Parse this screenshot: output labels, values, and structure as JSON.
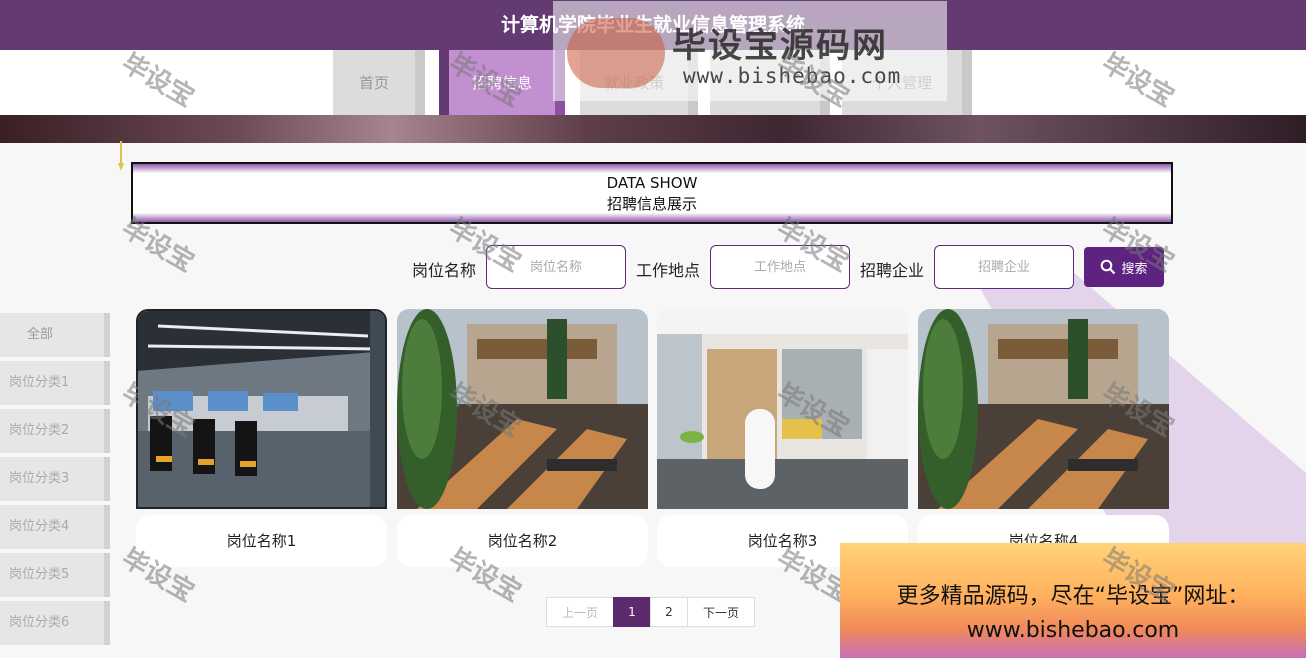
{
  "header": {
    "title": "计算机学院毕业生就业信息管理系统"
  },
  "nav": {
    "items": [
      {
        "label": "首页"
      },
      {
        "label": "招聘信息"
      },
      {
        "label": "就业政策"
      },
      {
        "label": ""
      },
      {
        "label": "个人管理"
      }
    ],
    "active": "招聘信息"
  },
  "section": {
    "title_en": "DATA SHOW",
    "title_cn": "招聘信息展示"
  },
  "search": {
    "position_label": "岗位名称",
    "position_placeholder": "岗位名称",
    "location_label": "工作地点",
    "location_placeholder": "工作地点",
    "company_label": "招聘企业",
    "company_placeholder": "招聘企业",
    "button_label": "搜索"
  },
  "sidebar": {
    "items": [
      {
        "label": "全部"
      },
      {
        "label": "岗位分类1"
      },
      {
        "label": "岗位分类2"
      },
      {
        "label": "岗位分类3"
      },
      {
        "label": "岗位分类4"
      },
      {
        "label": "岗位分类5"
      },
      {
        "label": "岗位分类6"
      }
    ]
  },
  "cards": [
    {
      "title": "岗位名称1",
      "image": "office-cubicles"
    },
    {
      "title": "岗位名称2",
      "image": "mcdonalds-patio"
    },
    {
      "title": "岗位名称3",
      "image": "lounge-interior"
    },
    {
      "title": "岗位名称4",
      "image": "mcdonalds-patio"
    }
  ],
  "pagination": {
    "prev": "上一页",
    "pages": [
      "1",
      "2"
    ],
    "current": "1",
    "next": "下一页"
  },
  "watermark": {
    "text": "毕设宝",
    "logo_title": "毕设宝源码网",
    "logo_url": "www.bishebao.com",
    "promo_line1": "更多精品源码，尽在“毕设宝”网址：",
    "promo_line2": "www.bishebao.com"
  },
  "colors": {
    "primary": "#633a72",
    "accent": "#c28fd0",
    "button": "#5e2380"
  }
}
